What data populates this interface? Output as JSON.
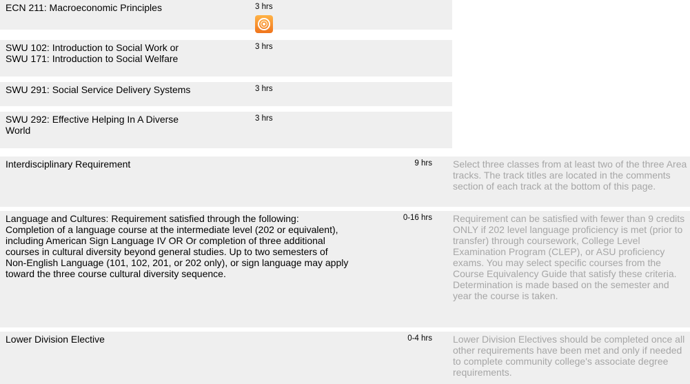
{
  "rows": [
    {
      "name": "ECN 211: Macroeconomic Principles",
      "hours": "3 hrs"
    },
    {
      "name": "SWU 102: Introduction to Social Work or SWU 171: Introduction to Social Welfare",
      "name_line1": "SWU 102: Introduction to Social Work or",
      "name_line2": "SWU 171: Introduction to Social Welfare",
      "hours": "3 hrs"
    },
    {
      "name": "SWU 291: Social Service Delivery Systems",
      "hours": "3 hrs"
    },
    {
      "name_line1": "SWU 292: Effective Helping In A Diverse",
      "name_line2": "World",
      "hours": "3 hrs"
    }
  ],
  "wide_rows": [
    {
      "name": "Interdisciplinary Requirement",
      "hours": "9 hrs",
      "comment": "Select three classes from at least two of the three Area tracks. The track titles are located in the comments section of each track at the bottom of this page."
    },
    {
      "name": "Language and Cultures: Requirement satisfied through the following: Completion of a language course at the intermediate level (202 or equivalent), including American Sign Language IV OR Or completion of three additional courses in cultural diversity beyond general studies. Up to two semesters of Non-English Language (101, 102, 201, or 202 only), or sign language may apply toward the three course cultural diversity sequence.",
      "hours": "0-16 hrs",
      "comment": "Requirement can be satisfied with fewer than 9 credits ONLY if 202 level language proficiency is met (prior to transfer) through coursework, College Level Examination Program (CLEP), or ASU proficiency exams. You may select specific courses from the Course Equivalency Guide that satisfy these criteria. Determination is made based on the semester and year the course is taken."
    },
    {
      "name": "Lower Division Elective",
      "hours": "0-4 hrs",
      "comment": "Lower Division Electives should be completed once all other requirements have been met and only if needed to complete community college's associate degree requirements."
    }
  ],
  "icons": {
    "orange": "orange-circle-icon"
  }
}
